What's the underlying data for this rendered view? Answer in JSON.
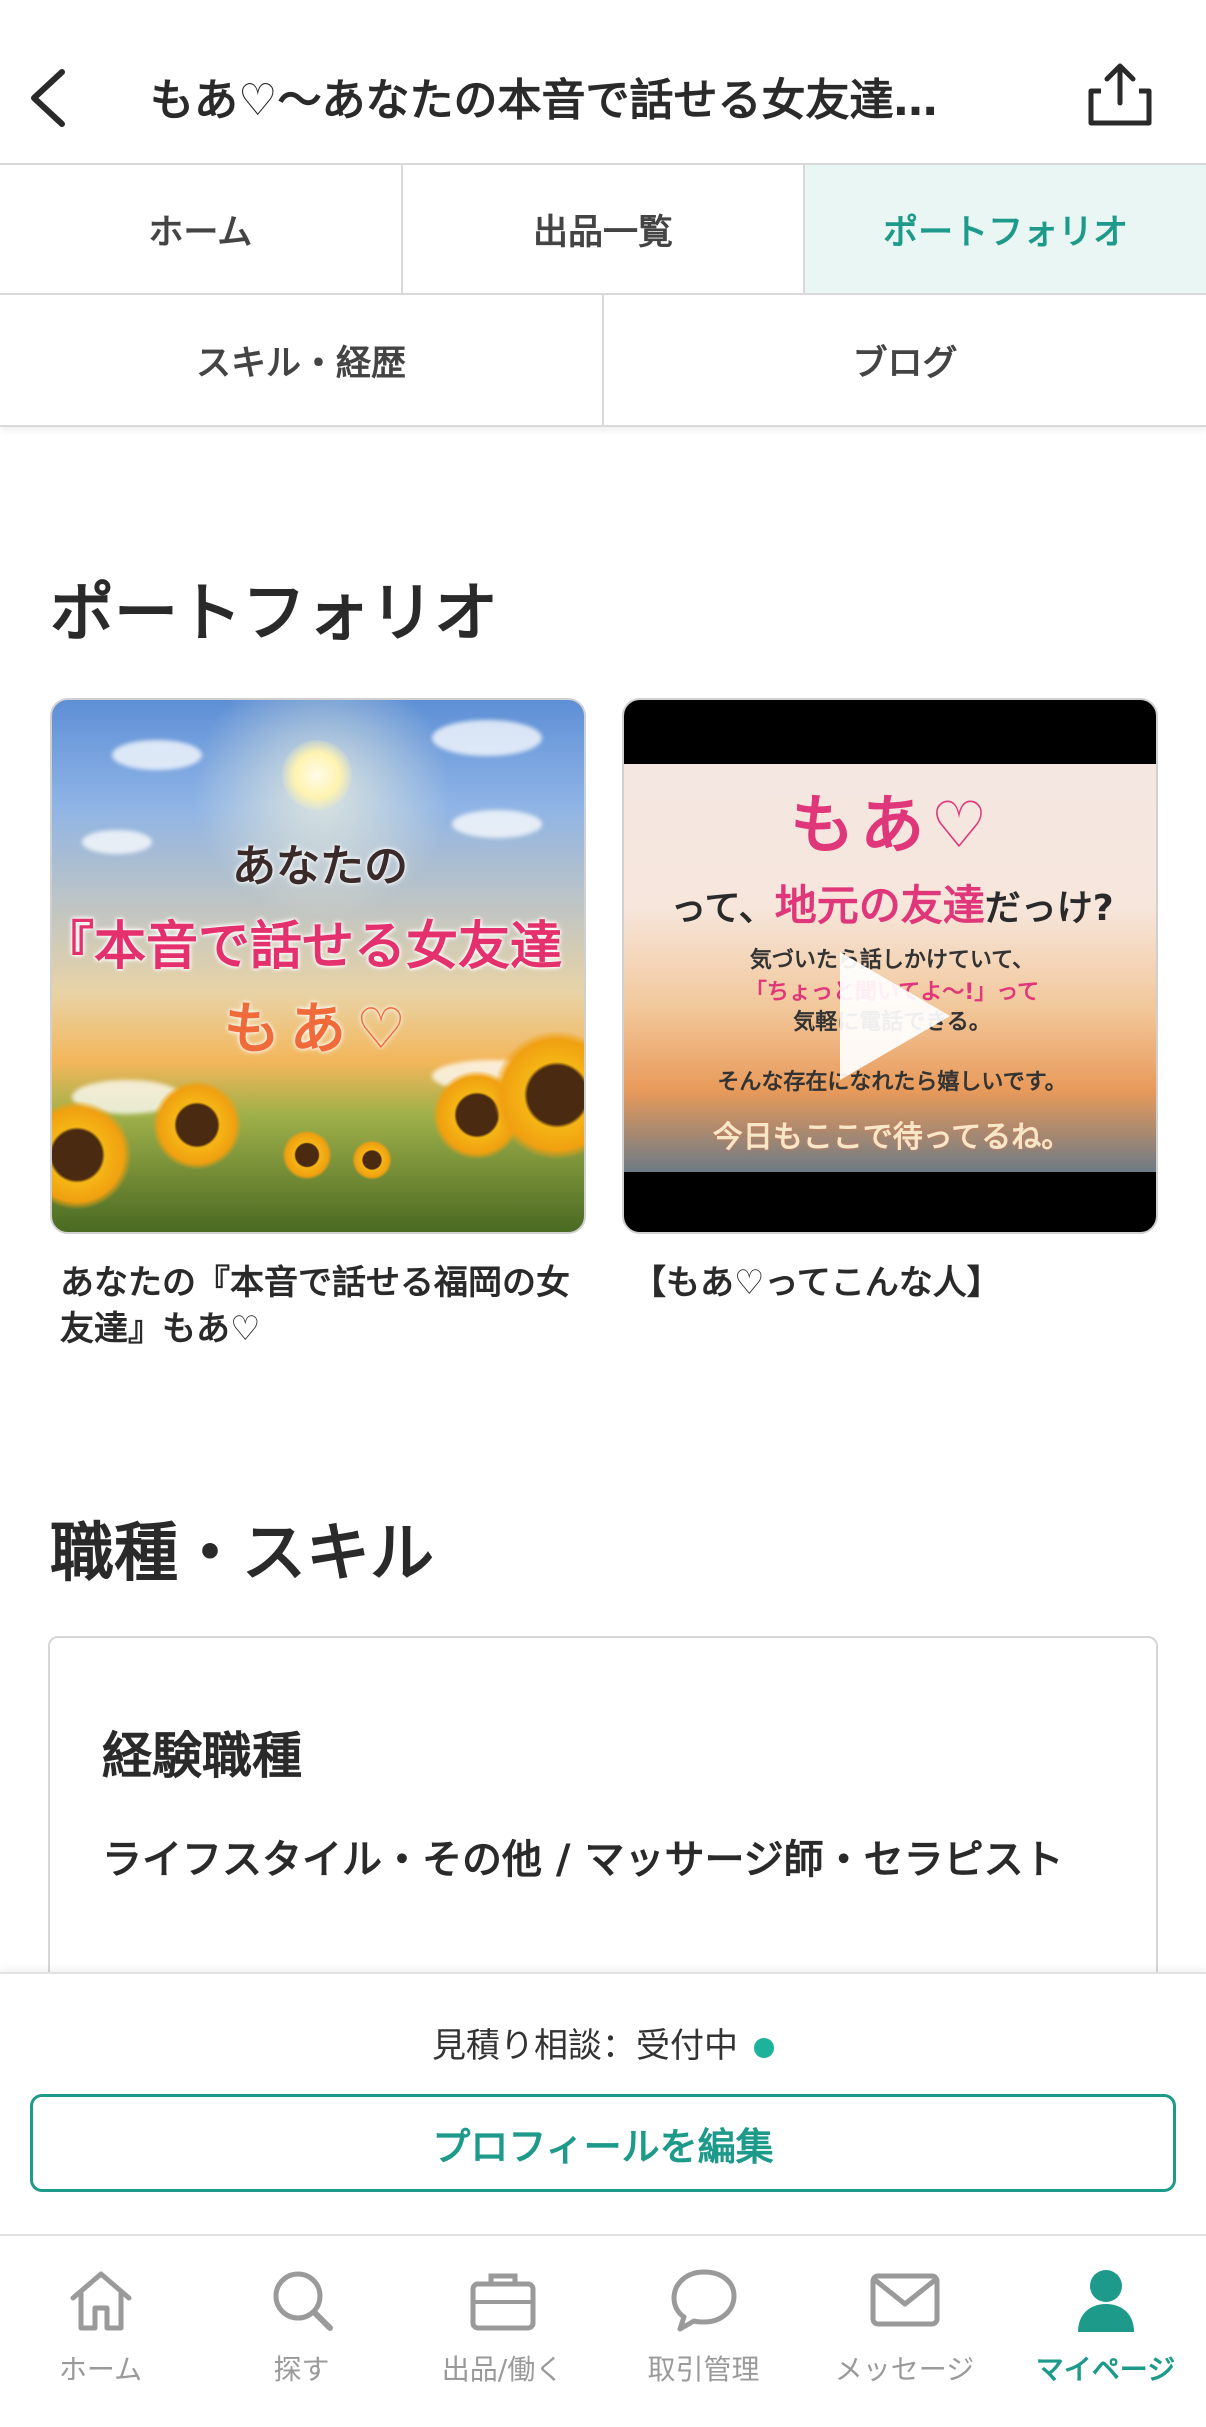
{
  "header": {
    "title": "もあ♡〜あなたの本音で話せる女友達…",
    "back_icon": "chevron-left-icon",
    "share_icon": "share-icon"
  },
  "tabs": {
    "row1": [
      "ホーム",
      "出品一覧",
      "ポートフォリオ"
    ],
    "row2": [
      "スキル・経歴",
      "ブログ"
    ],
    "active": "ポートフォリオ"
  },
  "portfolio": {
    "title": "ポートフォリオ",
    "items": [
      {
        "caption": "あなたの『本音で話せる福岡の女友達』もあ♡",
        "image_text": {
          "line1": "あなたの",
          "line2": "『本音で話せる女友達",
          "line3": "もあ♡"
        }
      },
      {
        "caption": "【もあ♡ってこんな人】",
        "image_text": {
          "line1": "もあ♡",
          "line2a": "って、",
          "line2b": "地元の友達",
          "line2c": "だっけ?",
          "line3": "気づいたら話しかけていて、",
          "line4": "「ちょっと聞いてよ〜!」って",
          "line5": "気軽に電話できる。",
          "line6": "そんな存在になれたら嬉しいです。",
          "line7": "今日もここで待ってるね。"
        }
      }
    ]
  },
  "skills": {
    "title": "職種・スキル",
    "heading": "経験職種",
    "text": "ライフスタイル・その他 / マッサージ師・セラピスト"
  },
  "action": {
    "status": "見積り相談：受付中",
    "status_color": "#1db39b",
    "edit_button": "プロフィールを編集"
  },
  "nav": {
    "items": [
      {
        "label": "ホーム",
        "icon": "home-icon"
      },
      {
        "label": "探す",
        "icon": "search-icon"
      },
      {
        "label": "出品/働く",
        "icon": "briefcase-icon"
      },
      {
        "label": "取引管理",
        "icon": "chat-bubble-icon"
      },
      {
        "label": "メッセージ",
        "icon": "mail-icon"
      },
      {
        "label": "マイページ",
        "icon": "person-icon"
      }
    ],
    "active": "マイページ"
  },
  "colors": {
    "accent": "#1d9a8a",
    "active_tab_bg": "#eaf6f4"
  }
}
